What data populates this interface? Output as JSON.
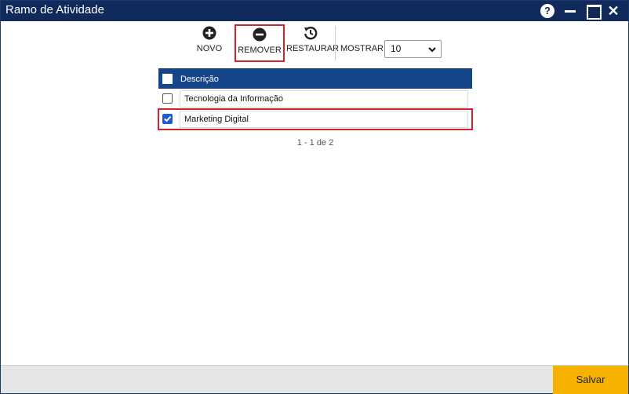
{
  "window": {
    "title": "Ramo de Atividade"
  },
  "toolbar": {
    "novo_label": "NOVO",
    "remover_label": "REMOVER",
    "restaurar_label": "RESTAURAR",
    "mostrar_label": "MOSTRAR:",
    "mostrar_value": "10"
  },
  "grid": {
    "header_label": "Descrição",
    "rows": [
      {
        "descricao": "Tecnologia da Informação",
        "checked": false
      },
      {
        "descricao": "Marketing Digital",
        "checked": true
      }
    ],
    "pager": "1 - 1 de 2"
  },
  "footer": {
    "save_label": "Salvar"
  },
  "colors": {
    "titlebar": "#102a5c",
    "header": "#17458a",
    "accent": "#f7b200",
    "highlight": "#d6222b"
  }
}
